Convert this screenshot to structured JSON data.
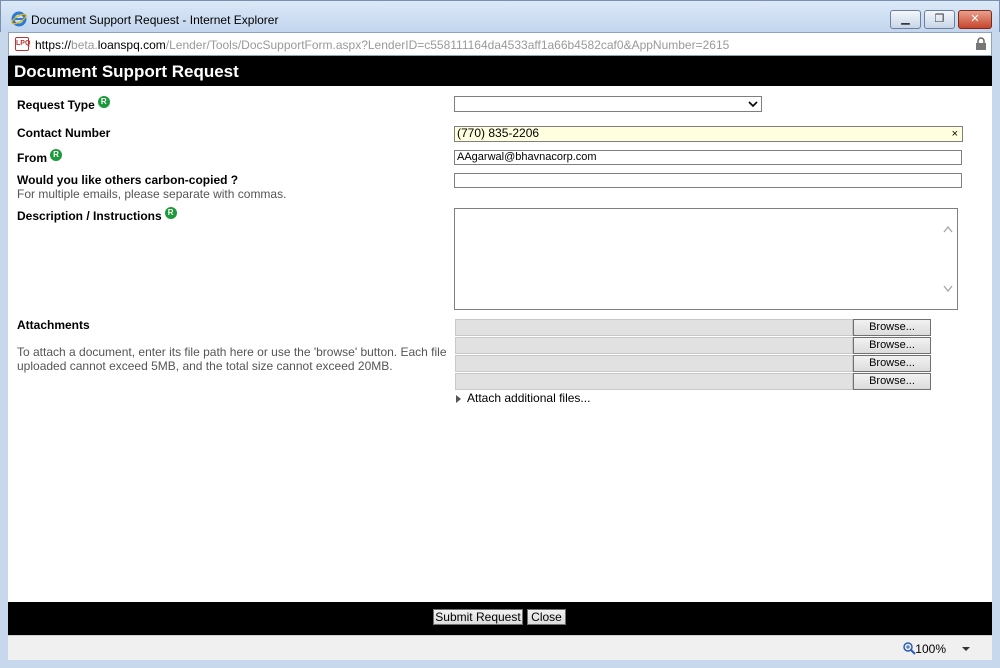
{
  "window": {
    "title": "Document Support Request - Internet Explorer",
    "minimize_label": "▁",
    "maximize_label": "❐",
    "close_label": "✕"
  },
  "address": {
    "scheme": "https://",
    "subdomain": "beta.",
    "domain": "loanspq.com",
    "path": "/Lender/Tools/DocSupportForm.aspx?LenderID=c558111164da4533aff1a66b4582caf0&AppNumber=2615",
    "favicon_text": "LPQ"
  },
  "page": {
    "title": "Document Support Request"
  },
  "form": {
    "request_type": {
      "label": "Request Type",
      "value": ""
    },
    "contact_number": {
      "label": "Contact Number",
      "value": "(770) 835-2206",
      "clear": "×"
    },
    "from": {
      "label": "From",
      "value": "AAgarwal@bhavnacorp.com"
    },
    "cc": {
      "label": "Would you like others carbon-copied ?",
      "hint": "For multiple emails, please separate with commas.",
      "value": ""
    },
    "description": {
      "label": "Description / Instructions",
      "value": ""
    },
    "attachments": {
      "label": "Attachments",
      "hint": "To attach a document, enter its file path here or use the 'browse' button. Each file uploaded cannot exceed 5MB, and the total size cannot exceed 20MB.",
      "browse_label": "Browse...",
      "more_label": "Attach additional files..."
    },
    "required_mark": "R"
  },
  "footer": {
    "submit_label": "Submit Request",
    "close_label": "Close"
  },
  "status": {
    "zoom": "100%"
  }
}
